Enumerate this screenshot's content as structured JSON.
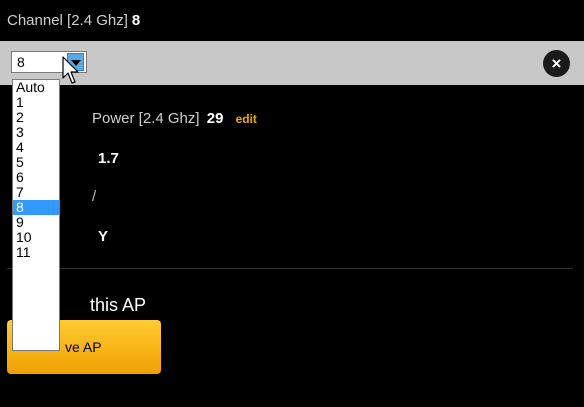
{
  "channel": {
    "label": "Channel [2.4 Ghz]",
    "value": "8",
    "select_value": "8",
    "options": [
      "Auto",
      "1",
      "2",
      "3",
      "4",
      "5",
      "6",
      "7",
      "8",
      "9",
      "10",
      "11"
    ],
    "highlighted_index": 8,
    "close_label": "×"
  },
  "tx_power": {
    "label_visible": "Power [2.4 Ghz]",
    "value": "29",
    "edit_label": "edit",
    "edit_color": "#f0a800"
  },
  "version": {
    "value_visible": "1.7"
  },
  "row4": {
    "value_visible": "/"
  },
  "row5": {
    "value_visible": "Y"
  },
  "forget": {
    "title_visible": "this AP",
    "button_label_visible": "ve AP"
  },
  "colors": {
    "accent": "#f0a800",
    "edit_bar": "#c8c8c8",
    "highlight": "#3399ff"
  }
}
